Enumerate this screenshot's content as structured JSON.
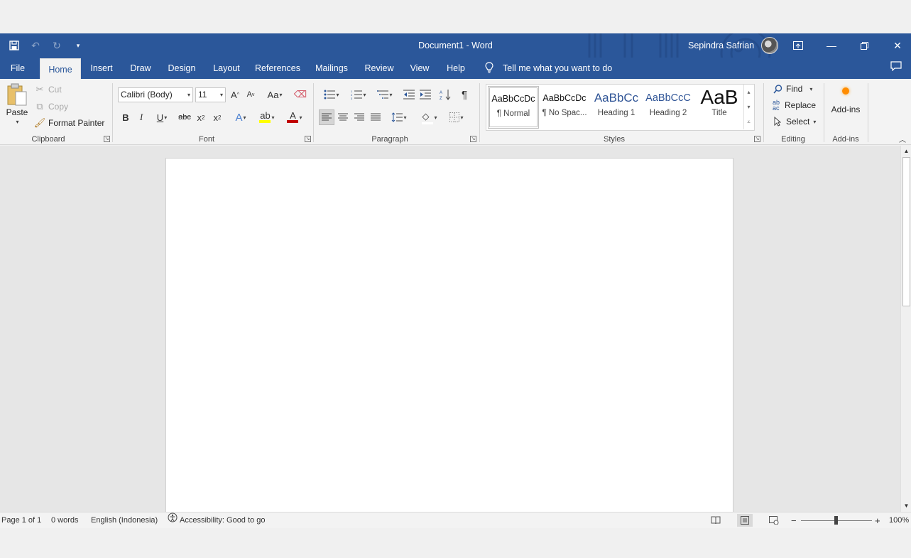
{
  "titlebar": {
    "document_title": "Document1  -  Word",
    "user_name": "Sepindra Safrian",
    "color": "#2b579a"
  },
  "tabs": [
    {
      "label": "File",
      "active": false
    },
    {
      "label": "Home",
      "active": true
    },
    {
      "label": "Insert",
      "active": false
    },
    {
      "label": "Draw",
      "active": false
    },
    {
      "label": "Design",
      "active": false
    },
    {
      "label": "Layout",
      "active": false
    },
    {
      "label": "References",
      "active": false
    },
    {
      "label": "Mailings",
      "active": false
    },
    {
      "label": "Review",
      "active": false
    },
    {
      "label": "View",
      "active": false
    },
    {
      "label": "Help",
      "active": false
    }
  ],
  "tellme": {
    "text": "Tell me what you want to do",
    "icon": "lightbulb-icon"
  },
  "clipboard": {
    "paste": "Paste",
    "cut": "Cut",
    "copy": "Copy",
    "format_painter": "Format Painter",
    "group": "Clipboard"
  },
  "font": {
    "family": "Calibri (Body)",
    "size": "11",
    "group": "Font",
    "bold": "B",
    "italic": "I",
    "underline": "U",
    "strike": "abc",
    "sub": "x",
    "sup": "x",
    "grow": "A",
    "shrink": "A",
    "case": "Aa",
    "effects": "A",
    "highlight_color": "#ffff00",
    "font_color": "#c00000"
  },
  "paragraph": {
    "group": "Paragraph",
    "pilcrow": "¶"
  },
  "styles": {
    "group": "Styles",
    "items": [
      {
        "preview": "AaBbCcDc",
        "name": "¶ Normal"
      },
      {
        "preview": "AaBbCcDc",
        "name": "¶ No Spac..."
      },
      {
        "preview": "AaBbCc",
        "name": "Heading 1"
      },
      {
        "preview": "AaBbCcC",
        "name": "Heading 2"
      },
      {
        "preview": "AaB",
        "name": "Title"
      }
    ]
  },
  "editing": {
    "group": "Editing",
    "find": "Find",
    "replace": "Replace",
    "select": "Select"
  },
  "addins": {
    "label": "Add-ins",
    "group": "Add-ins"
  },
  "status": {
    "page": "Page 1 of 1",
    "words": "0 words",
    "language": "English (Indonesia)",
    "accessibility": "Accessibility: Good to go",
    "zoom_minus": "−",
    "zoom_plus": "+",
    "zoom": "100%"
  }
}
